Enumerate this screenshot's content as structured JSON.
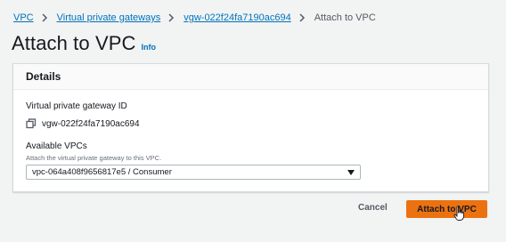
{
  "breadcrumb": {
    "items": [
      "VPC",
      "Virtual private gateways",
      "vgw-022f24fa7190ac694"
    ],
    "current": "Attach to VPC"
  },
  "header": {
    "title": "Attach to VPC",
    "info": "Info"
  },
  "details": {
    "heading": "Details",
    "gateway_id_label": "Virtual private gateway ID",
    "gateway_id_value": "vgw-022f24fa7190ac694",
    "vpcs_label": "Available VPCs",
    "vpcs_description": "Attach the virtual private gateway to this VPC.",
    "vpcs_selected": "vpc-064a408f9656817e5 / Consumer"
  },
  "actions": {
    "cancel": "Cancel",
    "submit": "Attach to VPC"
  },
  "colors": {
    "link": "#0073bb",
    "primary_button": "#ec7211",
    "page_background": "#f2f3f3"
  },
  "icons": [
    "chevron-right-icon",
    "copy-icon",
    "caret-down-icon",
    "hand-pointer-cursor-icon"
  ]
}
